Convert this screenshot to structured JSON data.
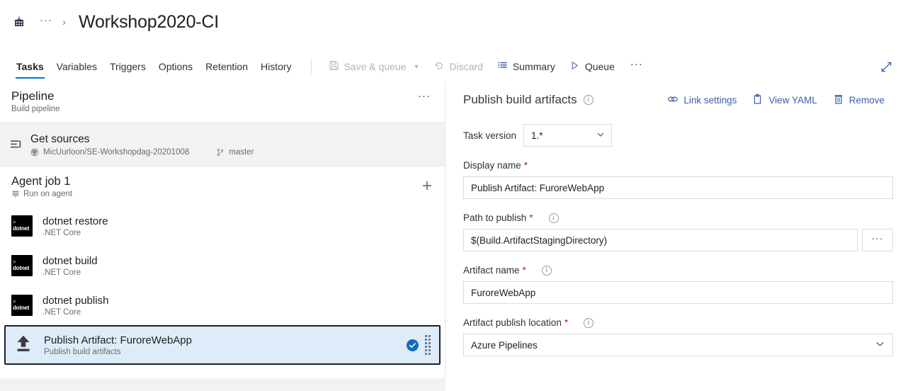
{
  "breadcrumb": {
    "icon": "pipeline-icon",
    "ellipsis": "···",
    "separator": "›",
    "title": "Workshop2020-CI"
  },
  "tabs": [
    {
      "label": "Tasks",
      "active": true
    },
    {
      "label": "Variables",
      "active": false
    },
    {
      "label": "Triggers",
      "active": false
    },
    {
      "label": "Options",
      "active": false
    },
    {
      "label": "Retention",
      "active": false
    },
    {
      "label": "History",
      "active": false
    }
  ],
  "toolbar": {
    "save_queue_label": "Save & queue",
    "discard_label": "Discard",
    "summary_label": "Summary",
    "queue_label": "Queue",
    "more_label": "···",
    "expand_icon": "expand-diagonal-icon"
  },
  "left_panel": {
    "header": {
      "title": "Pipeline",
      "subtitle": "Build pipeline",
      "more_label": "···"
    },
    "get_sources": {
      "title": "Get sources",
      "repo": "MicUurloon/SE-Workshopdag-20201008",
      "branch": "master"
    },
    "agent_job": {
      "title": "Agent job 1",
      "subtitle": "Run on agent",
      "add_label": "+"
    },
    "tasks": [
      {
        "title": "dotnet restore",
        "subtitle": ".NET Core",
        "icon": "dotnet-icon",
        "selected": false
      },
      {
        "title": "dotnet build",
        "subtitle": ".NET Core",
        "icon": "dotnet-icon",
        "selected": false
      },
      {
        "title": "dotnet publish",
        "subtitle": ".NET Core",
        "icon": "dotnet-icon",
        "selected": false
      },
      {
        "title": "Publish Artifact: FuroreWebApp",
        "subtitle": "Publish build artifacts",
        "icon": "upload-artifact-icon",
        "selected": true
      }
    ]
  },
  "right_panel": {
    "title": "Publish build artifacts",
    "actions": [
      {
        "label": "Link settings",
        "icon": "link-icon"
      },
      {
        "label": "View YAML",
        "icon": "clipboard-icon"
      },
      {
        "label": "Remove",
        "icon": "trash-icon"
      }
    ],
    "task_version": {
      "label": "Task version",
      "value": "1.*"
    },
    "fields": [
      {
        "label": "Display name",
        "required": true,
        "has_info": false,
        "value": "Publish Artifact: FuroreWebApp",
        "control": "text"
      },
      {
        "label": "Path to publish",
        "required": true,
        "has_info": true,
        "value": "$(Build.ArtifactStagingDirectory)",
        "control": "text-browse",
        "browse_label": "···"
      },
      {
        "label": "Artifact name",
        "required": true,
        "has_info": true,
        "value": "FuroreWebApp",
        "control": "text"
      },
      {
        "label": "Artifact publish location",
        "required": true,
        "has_info": true,
        "value": "Azure Pipelines",
        "control": "select"
      }
    ]
  },
  "colors": {
    "accent": "#0078d4",
    "link": "#3b5ea5",
    "selected_row_bg": "#deecf9",
    "selected_row_border": "#1b1f33",
    "required_star": "#a4262c"
  }
}
